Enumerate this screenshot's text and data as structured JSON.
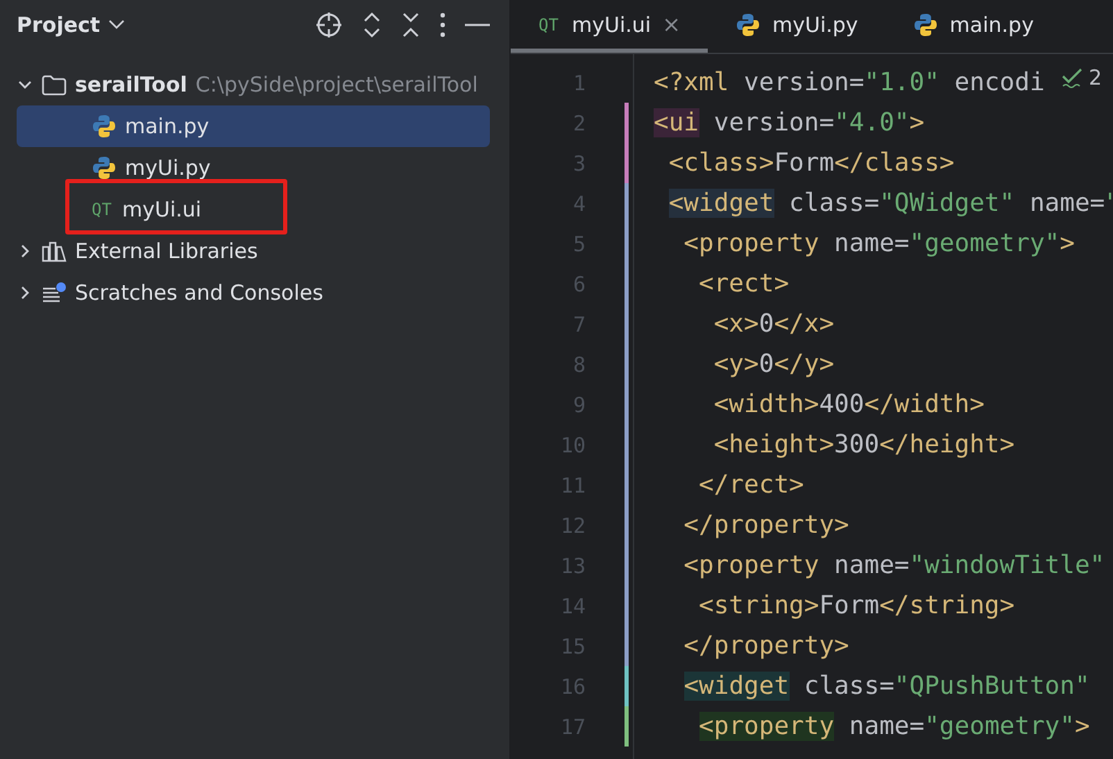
{
  "project_panel": {
    "title": "Project",
    "tree": [
      {
        "label": "serailTool",
        "path": "C:\\pySide\\project\\serailTool",
        "kind": "folder",
        "expanded": true,
        "selected": false,
        "children": [
          {
            "label": "main.py",
            "kind": "python",
            "selected": true
          },
          {
            "label": "myUi.py",
            "kind": "python",
            "selected": false
          },
          {
            "label": "myUi.ui",
            "kind": "qt",
            "badge": "QT",
            "selected": false,
            "annotated": true
          }
        ]
      },
      {
        "label": "External Libraries",
        "kind": "library",
        "expanded": false,
        "selected": false
      },
      {
        "label": "Scratches and Consoles",
        "kind": "scratches",
        "expanded": false,
        "selected": false
      }
    ]
  },
  "editor": {
    "tabs": [
      {
        "label": "myUi.ui",
        "kind": "qt",
        "badge": "QT",
        "close": "×",
        "selected": true
      },
      {
        "label": "myUi.py",
        "kind": "python",
        "selected": false
      },
      {
        "label": "main.py",
        "kind": "python",
        "selected": false
      }
    ],
    "inspection": {
      "count": "2"
    },
    "lines": [
      {
        "number": "1",
        "tokens": [
          {
            "kind": "tag",
            "text": "<?xml"
          },
          {
            "kind": "attr",
            "text": " version="
          },
          {
            "kind": "str",
            "text": "\"1.0\""
          },
          {
            "kind": "attr",
            "text": " encodi"
          }
        ]
      },
      {
        "number": "2",
        "color": "#c77dbb",
        "tokens": [
          {
            "kind": "tag",
            "text": "<ui",
            "color": "#3b2438"
          },
          {
            "kind": "attr",
            "text": " version="
          },
          {
            "kind": "str",
            "text": "\"4.0\""
          },
          {
            "kind": "tag",
            "text": ">"
          }
        ]
      },
      {
        "number": "3",
        "color": "#c77dbb",
        "tokens": [
          {
            "kind": "tag",
            "text": " <class>"
          },
          {
            "kind": "attr",
            "text": "Form"
          },
          {
            "kind": "tag",
            "text": "</class>"
          }
        ]
      },
      {
        "number": "4",
        "color": "#8c9ec7",
        "tokens": [
          {
            "kind": "tag",
            "text": " <widget",
            "color": "#25303d"
          },
          {
            "kind": "attr",
            "text": " class="
          },
          {
            "kind": "str",
            "text": "\"QWidget\""
          },
          {
            "kind": "attr",
            "text": " name="
          },
          {
            "kind": "str",
            "text": "\""
          }
        ]
      },
      {
        "number": "5",
        "color": "#8c9ec7",
        "tokens": [
          {
            "kind": "tag",
            "text": "  <property"
          },
          {
            "kind": "attr",
            "text": " name="
          },
          {
            "kind": "str",
            "text": "\"geometry\""
          },
          {
            "kind": "tag",
            "text": ">"
          }
        ]
      },
      {
        "number": "6",
        "color": "#8c9ec7",
        "tokens": [
          {
            "kind": "tag",
            "text": "   <rect>"
          }
        ]
      },
      {
        "number": "7",
        "color": "#8c9ec7",
        "tokens": [
          {
            "kind": "tag",
            "text": "    <x>"
          },
          {
            "kind": "attr",
            "text": "0"
          },
          {
            "kind": "tag",
            "text": "</x>"
          }
        ]
      },
      {
        "number": "8",
        "color": "#8c9ec7",
        "tokens": [
          {
            "kind": "tag",
            "text": "    <y>"
          },
          {
            "kind": "attr",
            "text": "0"
          },
          {
            "kind": "tag",
            "text": "</y>"
          }
        ]
      },
      {
        "number": "9",
        "color": "#8c9ec7",
        "tokens": [
          {
            "kind": "tag",
            "text": "    <width>"
          },
          {
            "kind": "attr",
            "text": "400"
          },
          {
            "kind": "tag",
            "text": "</width>"
          }
        ]
      },
      {
        "number": "10",
        "color": "#8c9ec7",
        "tokens": [
          {
            "kind": "tag",
            "text": "    <height>"
          },
          {
            "kind": "attr",
            "text": "300"
          },
          {
            "kind": "tag",
            "text": "</height>"
          }
        ]
      },
      {
        "number": "11",
        "color": "#8c9ec7",
        "tokens": [
          {
            "kind": "tag",
            "text": "   </rect>"
          }
        ]
      },
      {
        "number": "12",
        "color": "#8c9ec7",
        "tokens": [
          {
            "kind": "tag",
            "text": "  </property>"
          }
        ]
      },
      {
        "number": "13",
        "color": "#8c9ec7",
        "tokens": [
          {
            "kind": "tag",
            "text": "  <property"
          },
          {
            "kind": "attr",
            "text": " name="
          },
          {
            "kind": "str",
            "text": "\"windowTitle\""
          }
        ]
      },
      {
        "number": "14",
        "color": "#8c9ec7",
        "tokens": [
          {
            "kind": "tag",
            "text": "   <string>"
          },
          {
            "kind": "attr",
            "text": "Form"
          },
          {
            "kind": "tag",
            "text": "</string>"
          }
        ]
      },
      {
        "number": "15",
        "color": "#8c9ec7",
        "tokens": [
          {
            "kind": "tag",
            "text": "  </property>"
          }
        ]
      },
      {
        "number": "16",
        "color": "#6fc2c2",
        "tokens": [
          {
            "kind": "tag",
            "text": "  <widget",
            "color": "#1b3537"
          },
          {
            "kind": "attr",
            "text": " class="
          },
          {
            "kind": "str",
            "text": "\"QPushButton\""
          }
        ]
      },
      {
        "number": "17",
        "color": "#7fbf7f",
        "tokens": [
          {
            "kind": "tag",
            "text": "   <property",
            "color": "#1f3520"
          },
          {
            "kind": "attr",
            "text": " name="
          },
          {
            "kind": "str",
            "text": "\"geometry\""
          },
          {
            "kind": "tag",
            "text": ">"
          }
        ]
      }
    ]
  }
}
